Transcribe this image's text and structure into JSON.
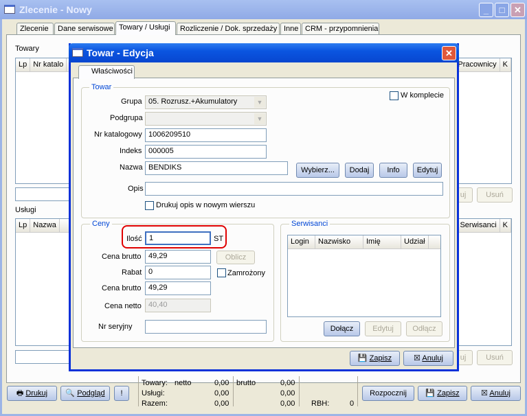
{
  "main_window": {
    "title": "Zlecenie - Nowy",
    "tabs": [
      "Zlecenie",
      "Dane serwisowe",
      "Towary / Usługi",
      "Rozliczenie / Dok. sprzedaży",
      "Inne",
      "CRM - przypomnienia"
    ],
    "active_tab": "Towary / Usługi",
    "towary_label": "Towary",
    "towary_columns": [
      "Lp",
      "Nr katalo",
      "Pracownicy",
      "K"
    ],
    "uslugi_label": "Usługi",
    "uslugi_columns": [
      "Lp",
      "Nazwa",
      "Serwisanci",
      "K"
    ],
    "edit_button_partial": "uj",
    "delete_button": "Usuń",
    "footer": {
      "print": "Drukuj",
      "preview": "Podgląd",
      "towary_label": "Towary:",
      "netto_label": "netto",
      "towary_netto": "0,00",
      "brutto_label": "brutto",
      "towary_brutto": "0,00",
      "uslugi_label": "Usługi:",
      "uslugi_netto": "0,00",
      "uslugi_brutto": "0,00",
      "razem_label": "Razem:",
      "razem_netto": "0,00",
      "razem_brutto": "0,00",
      "rbh_label": "RBH:",
      "rbh_value": "0",
      "start": "Rozpocznij",
      "save": "Zapisz",
      "cancel": "Anuluj"
    }
  },
  "dialog": {
    "title": "Towar - Edycja",
    "tab": "Właściwości",
    "towar": {
      "legend": "Towar",
      "grupa_label": "Grupa",
      "grupa_value": "05. Rozrusz.+Akumulatory",
      "podgrupa_label": "Podgrupa",
      "podgrupa_value": "",
      "nr_kat_label": "Nr katalogowy",
      "nr_kat_value": "1006209510",
      "indeks_label": "Indeks",
      "indeks_value": "000005",
      "nazwa_label": "Nazwa",
      "nazwa_value": "BENDIKS",
      "opis_label": "Opis",
      "opis_value": "",
      "w_komplecie": "W komplecie",
      "drukuj_opis": "Drukuj opis w nowym wierszu",
      "buttons": [
        "Wybierz...",
        "Dodaj",
        "Info",
        "Edytuj"
      ]
    },
    "ceny": {
      "legend": "Ceny",
      "ilosc_label": "Ilość",
      "ilosc_value": "1",
      "unit": "ST",
      "cena_brutto_label": "Cena brutto",
      "cena_brutto_value": "49,29",
      "oblicz": "Oblicz",
      "rabat_label": "Rabat",
      "rabat_value": "0",
      "zamrozony": "Zamrożony",
      "cena_brutto2_label": "Cena brutto",
      "cena_brutto2_value": "49,29",
      "cena_netto_label": "Cena netto",
      "cena_netto_value": "40,40",
      "nr_seryjny_label": "Nr seryjny",
      "nr_seryjny_value": ""
    },
    "serwisanci": {
      "legend": "Serwisanci",
      "columns": [
        "Login",
        "Nazwisko",
        "Imię",
        "Udział"
      ],
      "buttons": [
        "Dołącz",
        "Edytuj",
        "Odłącz"
      ]
    },
    "save": "Zapisz",
    "cancel": "Anuluj"
  },
  "colors": {
    "highlight": "#e00000",
    "accent": "#0a55e0"
  }
}
